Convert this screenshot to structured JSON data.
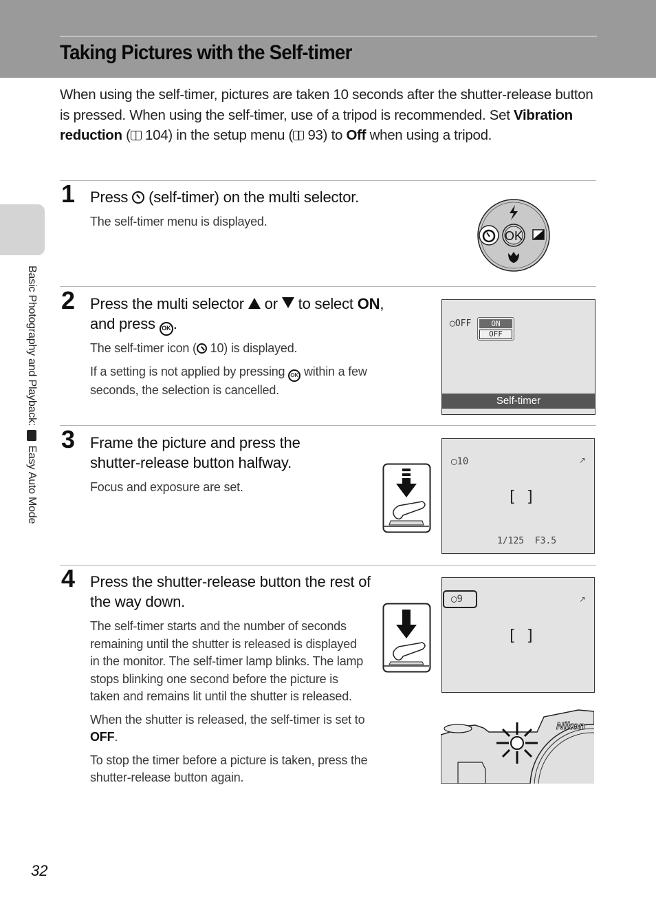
{
  "header": {
    "title": "Taking Pictures with the Self-timer"
  },
  "intro": {
    "part1": "When using the self-timer, pictures are taken 10 seconds after the shutter-release button is pressed. When using the self-timer, use of a tripod is recommended. Set ",
    "bold1": "Vibration reduction",
    "part2": " (",
    "ref1": " 104) in the setup menu (",
    "ref2": " 93) to ",
    "bold2": "Off",
    "part3": " when using a tripod."
  },
  "side_tab": {
    "text_before": "Basic Photography and Playback: ",
    "text_after": " Easy Auto Mode"
  },
  "steps": [
    {
      "number": "1",
      "head_before": "Press ",
      "head_after": " (self-timer) on the multi selector.",
      "body": [
        "The self-timer menu is displayed."
      ]
    },
    {
      "number": "2",
      "head_a": "Press the multi selector ",
      "head_b": " or ",
      "head_c": " to select ",
      "head_bold": "ON",
      "head_d": ",",
      "head_e": "and press ",
      "head_f": ".",
      "body1_before": "The self-timer icon (",
      "body1_after": " 10) is displayed.",
      "body2_before": "If a setting is not applied by pressing ",
      "body2_after": " within a few seconds, the selection is cancelled."
    },
    {
      "number": "3",
      "head": "Frame the picture and press the shutter-release button halfway.",
      "body": [
        "Focus and exposure are set."
      ]
    },
    {
      "number": "4",
      "head": "Press the shutter-release button the rest of the way down.",
      "body1": "The self-timer starts and the number of seconds remaining until the shutter is released is displayed in the monitor. The self-timer lamp blinks. The lamp stops blinking one second before the picture is taken and remains lit until the shutter is released.",
      "body2_before": "When the shutter is released, the self-timer is set to ",
      "body2_bold": "OFF",
      "body2_after": ".",
      "body3": "To stop the timer before a picture is taken, press the shutter-release button again."
    }
  ],
  "multi_selector": {
    "center_label": "OK"
  },
  "screen_menu": {
    "icon_text": "OFF",
    "options": [
      "ON",
      "OFF"
    ],
    "selected": "ON",
    "footer": "Self-timer"
  },
  "screen_half": {
    "timer": "10",
    "shutter": "1/125",
    "aperture": "F3.5"
  },
  "screen_full": {
    "timer": "9"
  },
  "camera": {
    "brand": "Nikon"
  },
  "page_number": "32"
}
